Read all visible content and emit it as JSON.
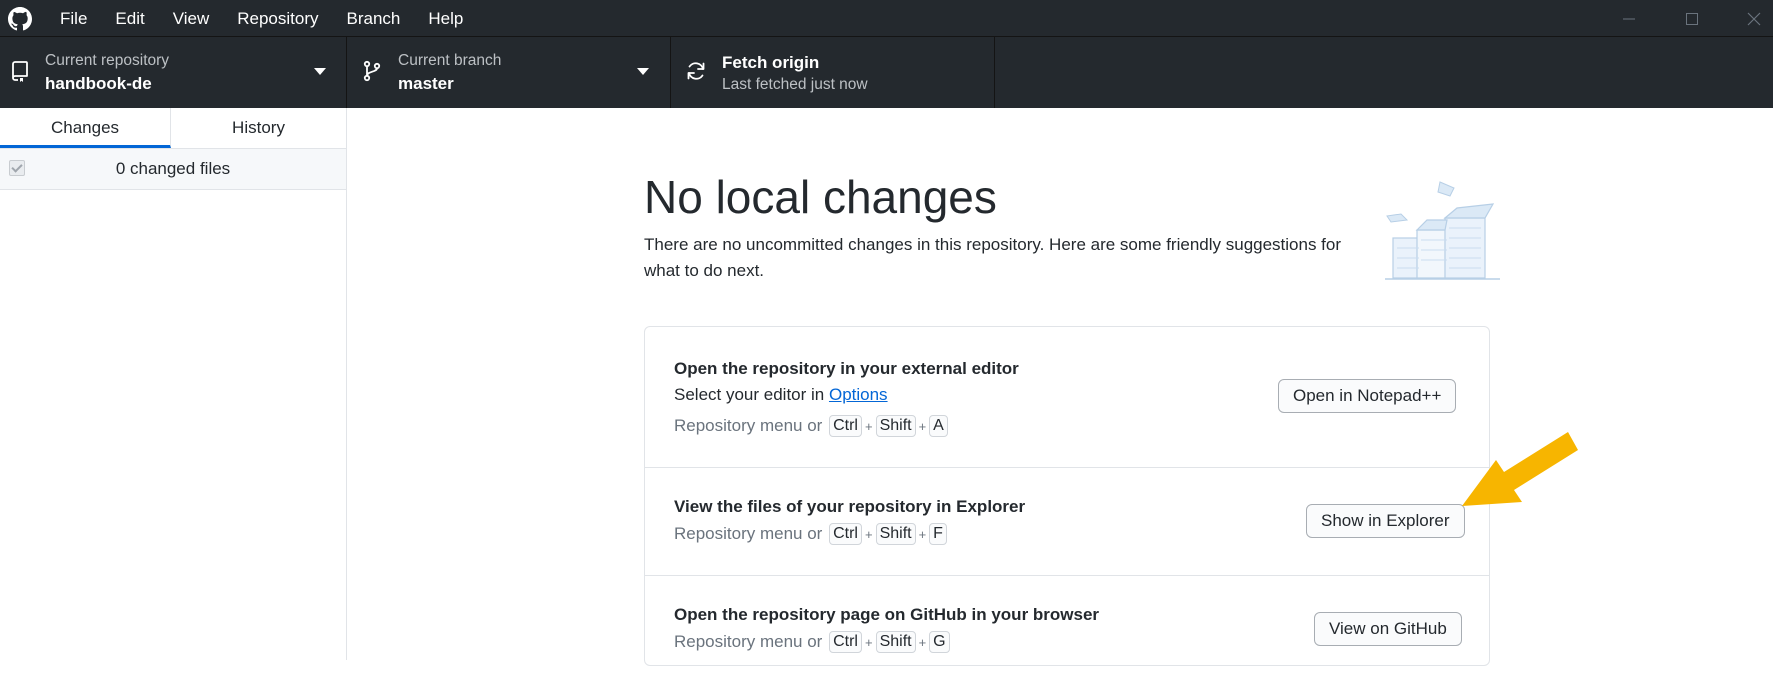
{
  "menu": [
    "File",
    "Edit",
    "View",
    "Repository",
    "Branch",
    "Help"
  ],
  "toolbar": {
    "repository": {
      "label": "Current repository",
      "value": "handbook-de"
    },
    "branch": {
      "label": "Current branch",
      "value": "master"
    },
    "fetch": {
      "title": "Fetch origin",
      "status": "Last fetched just now"
    }
  },
  "sidebar": {
    "tabs": [
      "Changes",
      "History"
    ],
    "active_tab": "Changes",
    "changed_files": "0 changed files"
  },
  "main": {
    "title": "No local changes",
    "description": "There are no uncommitted changes in this repository. Here are some friendly suggestions for what to do next.",
    "suggestions": [
      {
        "title": "Open the repository in your external editor",
        "subtitle_prefix": "Select your editor in ",
        "subtitle_link": "Options",
        "shortcut_prefix": "Repository menu or",
        "keys": [
          "Ctrl",
          "Shift",
          "A"
        ],
        "button": "Open in Notepad++"
      },
      {
        "title": "View the files of your repository in Explorer",
        "shortcut_prefix": "Repository menu or",
        "keys": [
          "Ctrl",
          "Shift",
          "F"
        ],
        "button": "Show in Explorer"
      },
      {
        "title": "Open the repository page on GitHub in your browser",
        "shortcut_prefix": "Repository menu or",
        "keys": [
          "Ctrl",
          "Shift",
          "G"
        ],
        "button": "View on GitHub"
      }
    ]
  },
  "colors": {
    "chrome": "#24292e",
    "accent": "#0366d6",
    "annotation_arrow": "#f7b500"
  }
}
